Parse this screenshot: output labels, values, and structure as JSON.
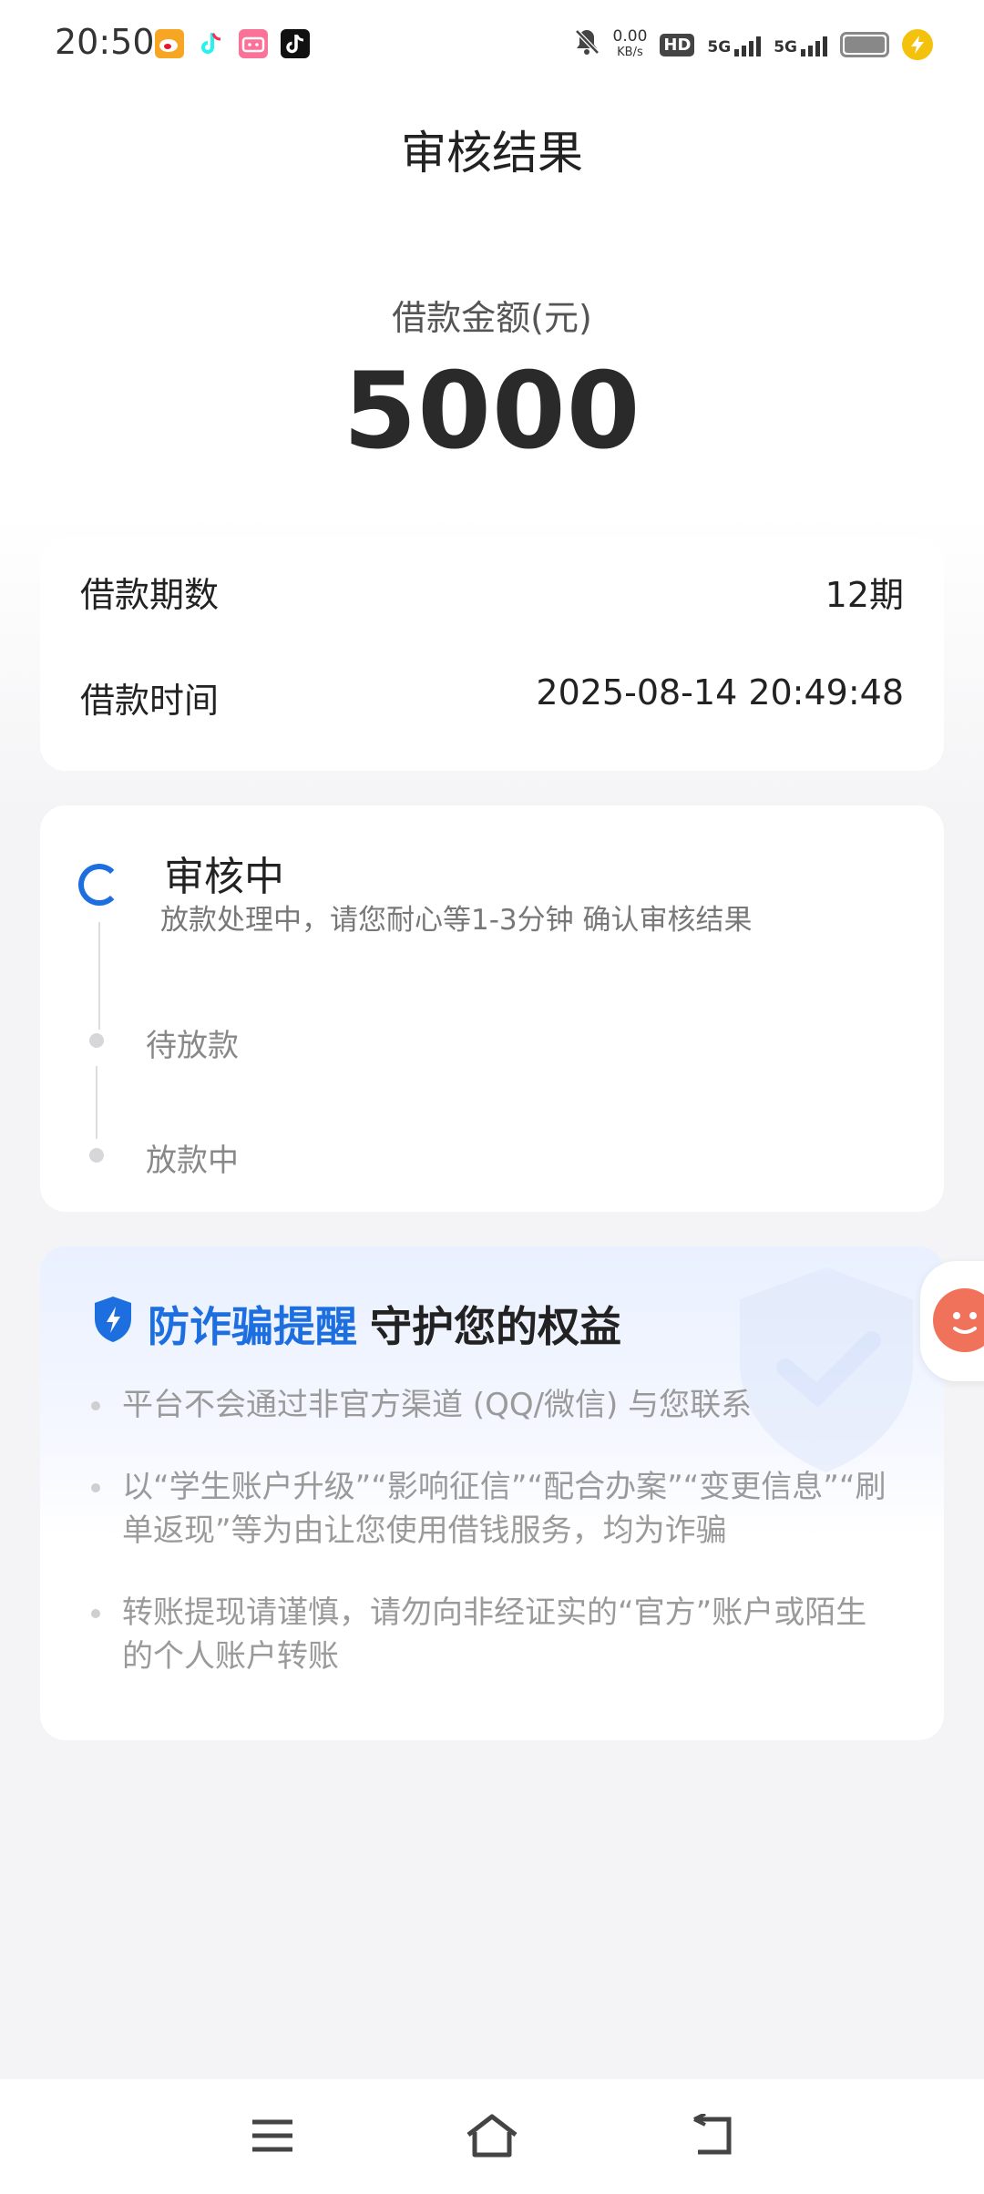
{
  "status_bar": {
    "time": "20:50",
    "net_speed_value": "0.00",
    "net_speed_unit": "KB/s",
    "hd_label": "HD",
    "sim1_label": "5G",
    "sim2_label": "5G",
    "app_icons": [
      "weibo-icon",
      "tiktok-icon",
      "bilibili-icon",
      "douyin-icon"
    ]
  },
  "header": {
    "title": "审核结果"
  },
  "loan": {
    "amount_label": "借款金额(元)",
    "amount": "5000"
  },
  "details": {
    "period_label": "借款期数",
    "period_value": "12期",
    "time_label": "借款时间",
    "time_value": "2025-08-14 20:49:48"
  },
  "progress": {
    "current_title": "审核中",
    "current_desc": "放款处理中，请您耐心等1-3分钟 确认审核结果",
    "step2": "待放款",
    "step3": "放款中"
  },
  "fraud_notice": {
    "title_highlight": "防诈骗提醒",
    "title_rest": "守护您的权益",
    "items": [
      "平台不会通过非官方渠道 (QQ/微信) 与您联系",
      "以“学生账户升级”“影响征信”“配合办案”“变更信息”“刷单返现”等为由让您使用借钱服务，均为诈骗",
      "转账提现请谨慎，请勿向非经证实的“官方”账户或陌生的个人账户转账"
    ]
  },
  "colors": {
    "accent": "#1d6fe0",
    "background": "#f4f4f6"
  }
}
